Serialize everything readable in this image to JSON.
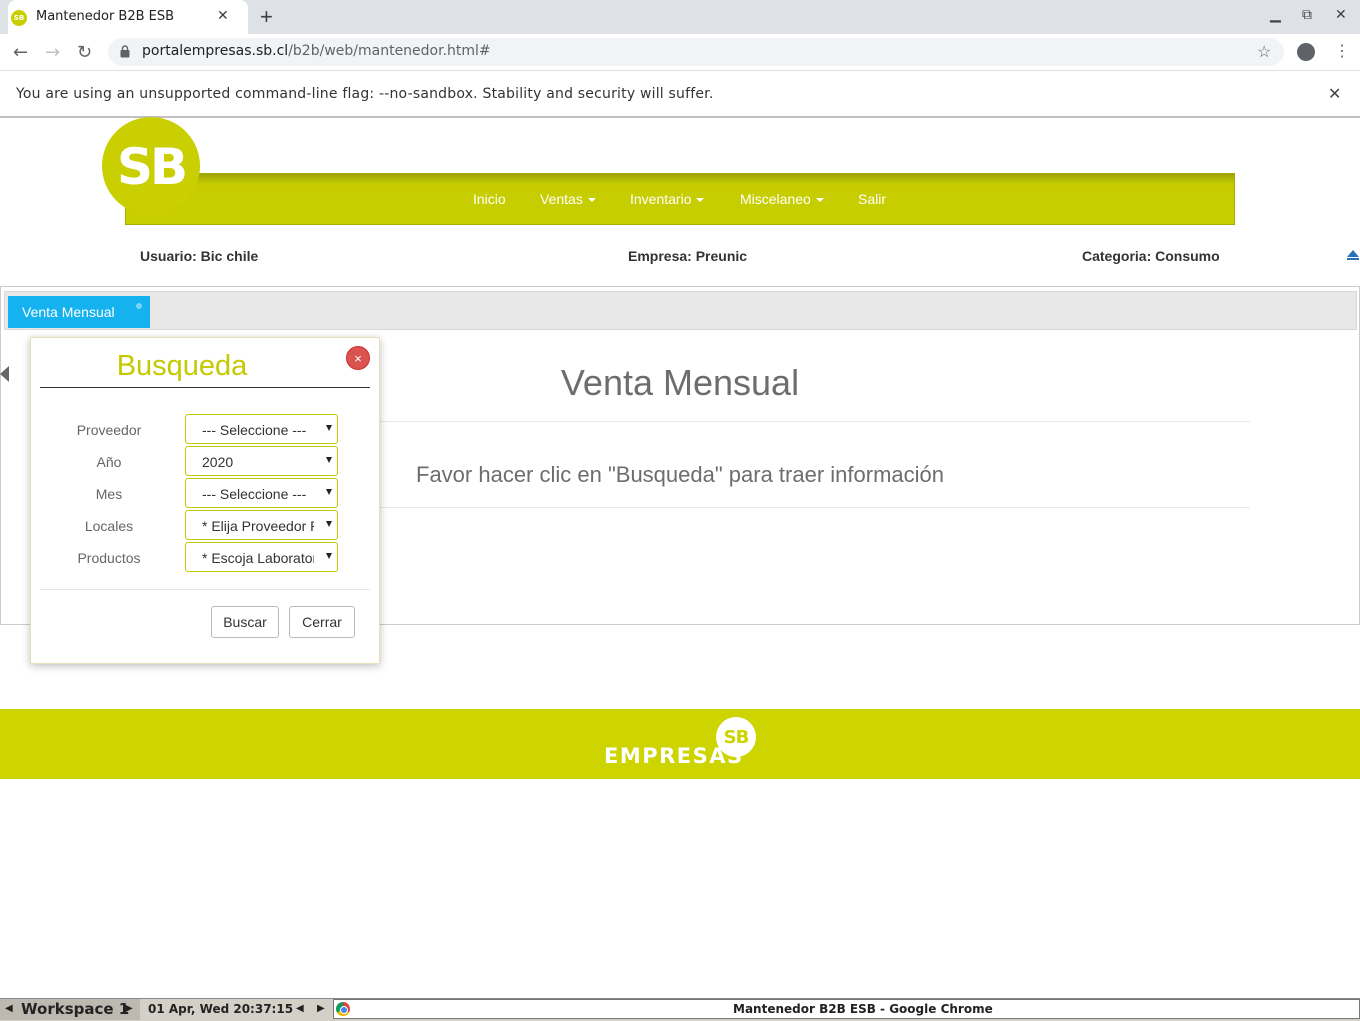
{
  "browser": {
    "tab_title": "Mantenedor B2B ESB",
    "tab_favicon_text": "SB",
    "url_host": "portalempresas.sb.cl",
    "url_path": "/b2b/web/mantenedor.html#",
    "infobar_message": "You are using an unsupported command-line flag: --no-sandbox. Stability and security will suffer."
  },
  "site": {
    "logo_text": "SB",
    "nav": {
      "inicio": "Inicio",
      "ventas": "Ventas",
      "inventario": "Inventario",
      "miscelaneo": "Miscelaneo",
      "salir": "Salir"
    },
    "user_info": {
      "usuario": "Usuario: Bic chile",
      "empresa": "Empresa: Preunic",
      "categoria": "Categoria: Consumo"
    },
    "brand_color": "#c8cf00"
  },
  "main": {
    "tab_label": "Venta Mensual",
    "title": "Venta Mensual",
    "message": "Favor hacer clic en \"Busqueda\" para traer información"
  },
  "dialog": {
    "title": "Busqueda",
    "close_symbol": "×",
    "fields": {
      "proveedor": {
        "label": "Proveedor",
        "value": "--- Seleccione ---"
      },
      "anio": {
        "label": "Año",
        "value": "2020"
      },
      "mes": {
        "label": "Mes",
        "value": "--- Seleccione ---"
      },
      "locales": {
        "label": "Locales",
        "value": "* Elija Proveedor Primero"
      },
      "productos": {
        "label": "Productos",
        "value": "* Escoja Laboratorio"
      }
    },
    "buscar_label": "Buscar",
    "cerrar_label": "Cerrar"
  },
  "footer": {
    "brand_text": "EMPRESAS",
    "brand_badge": "SB"
  },
  "taskbar": {
    "workspace": "Workspace 1",
    "datetime": "01 Apr, Wed 20:37:15",
    "window_title": "Mantenedor B2B ESB - Google Chrome"
  }
}
